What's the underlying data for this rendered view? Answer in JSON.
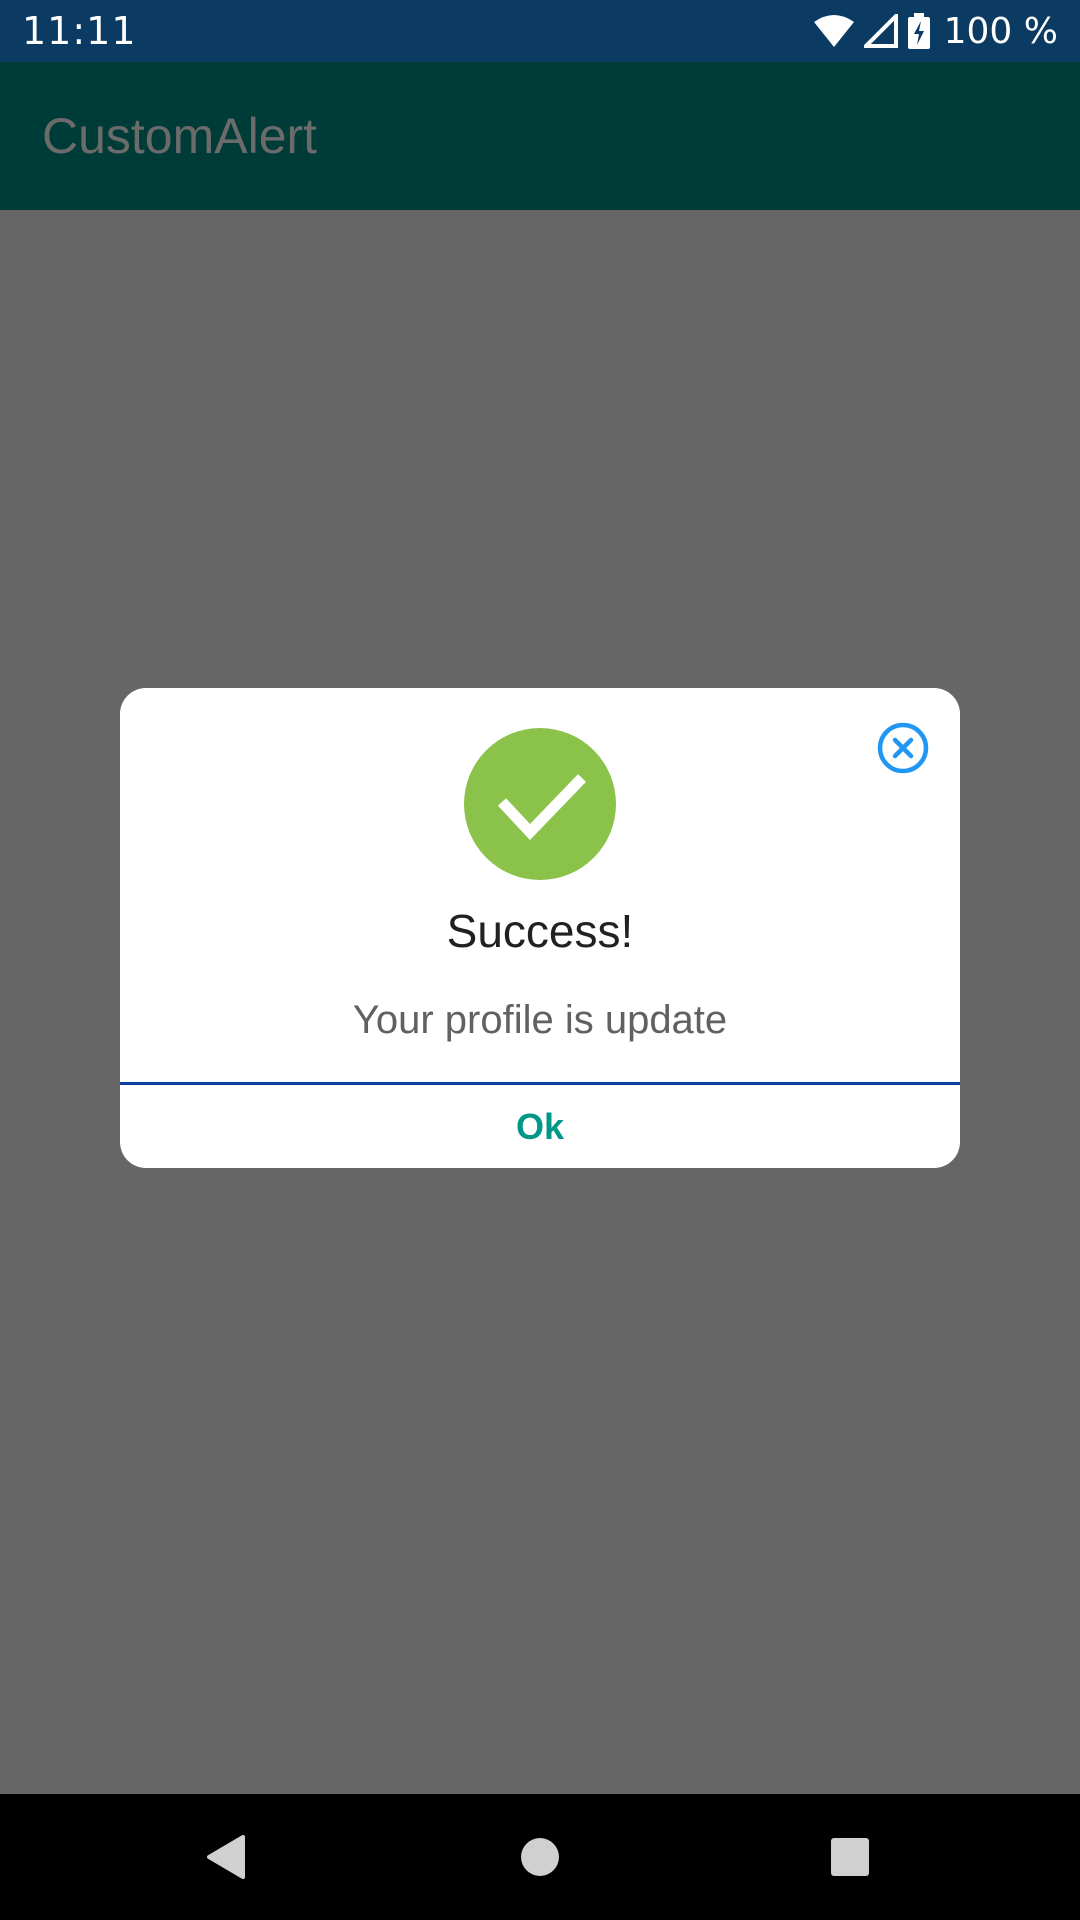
{
  "status_bar": {
    "time": "11:11",
    "battery_text": "100 %",
    "icons": [
      "wifi-icon",
      "cell-signal-icon",
      "battery-charging-icon"
    ],
    "background_color": "#0b3a62"
  },
  "app_bar": {
    "title": "CustomAlert",
    "background_color": "#003c37"
  },
  "dialog": {
    "icon": "checkmark-icon",
    "icon_color": "#8bc34a",
    "close_icon": "close-circle-icon",
    "close_icon_color": "#2196f3",
    "title": "Success!",
    "message": "Your profile is update",
    "ok_label": "Ok",
    "ok_color": "#009688",
    "divider_color": "#0d3fa0"
  },
  "navigation_bar": {
    "buttons": [
      "back-icon",
      "home-icon",
      "recents-icon"
    ]
  }
}
